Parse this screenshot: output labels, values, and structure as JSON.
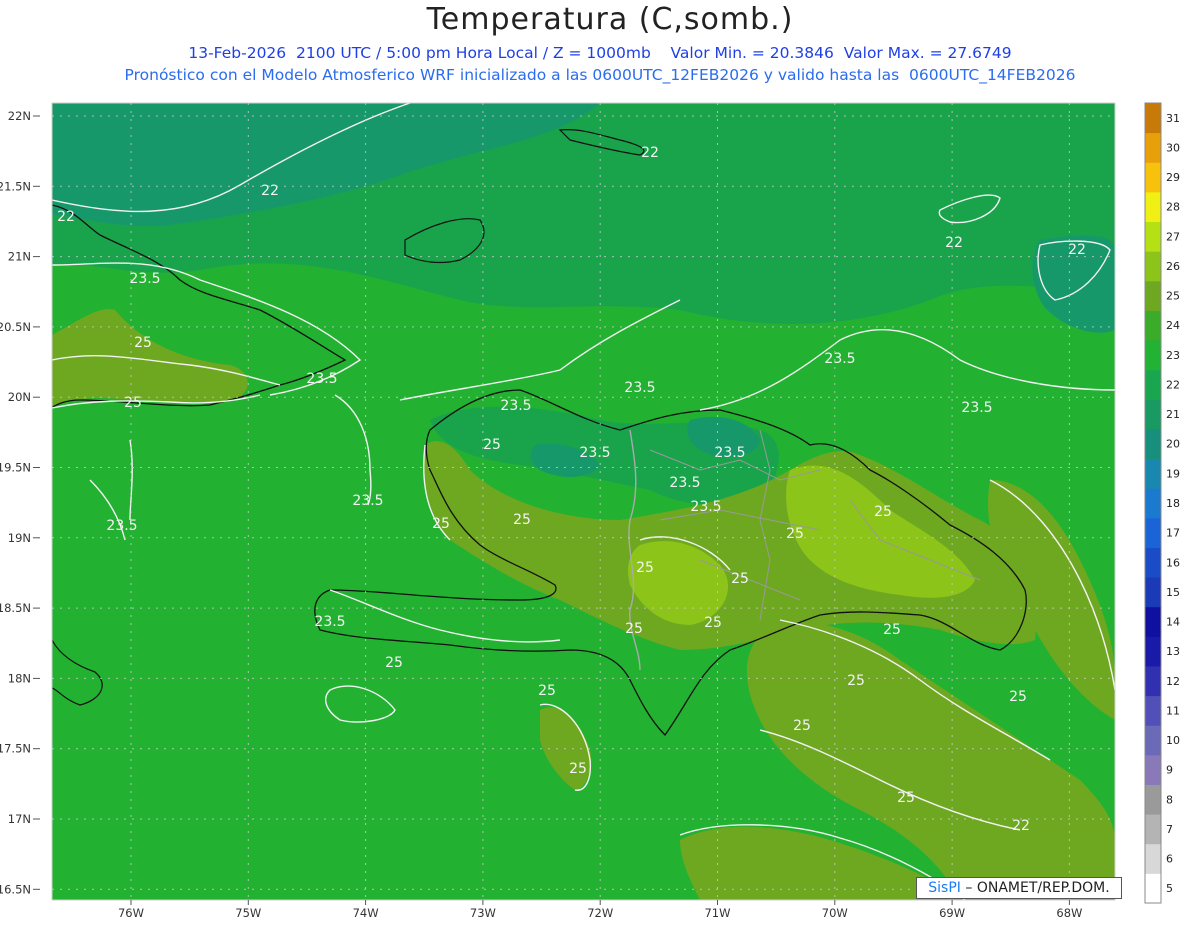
{
  "title": "Temperatura (C,somb.)",
  "subtitle_line1": "13-Feb-2026  2100 UTC / 5:00 pm Hora Local / Z = 1000mb    Valor Min. = 20.3846  Valor Max. = 27.6749",
  "subtitle_line2": "Pronóstico con el Modelo Atmosferico WRF inicializado a las 0600UTC_12FEB2026 y valido hasta las  0600UTC_14FEB2026",
  "credit": {
    "brand": "SisPI",
    "text": " – ONAMET/REP.DOM."
  },
  "lat_labels": [
    "22N",
    "21.5N",
    "21N",
    "20.5N",
    "20N",
    "19.5N",
    "19N",
    "18.5N",
    "18N",
    "17.5N",
    "17N",
    "16.5N"
  ],
  "lon_labels": [
    "76W",
    "75W",
    "74W",
    "73W",
    "72W",
    "71W",
    "70W",
    "69W",
    "68W"
  ],
  "colorbar": {
    "labels": [
      "5",
      "6",
      "7",
      "8",
      "9",
      "10",
      "11",
      "12",
      "13",
      "14",
      "15",
      "16",
      "17",
      "18",
      "19",
      "20",
      "21",
      "22",
      "23",
      "24",
      "25",
      "26",
      "27",
      "28",
      "29",
      "30",
      "31"
    ],
    "colors": [
      "#ffffff",
      "#d8d8d8",
      "#b4b4b4",
      "#9a9a9a",
      "#8a79b8",
      "#6a6ab8",
      "#5050b8",
      "#3030b0",
      "#1a1aa8",
      "#1010a0",
      "#1a3ab8",
      "#1a4cc8",
      "#1a64d8",
      "#1a7ad0",
      "#1888b0",
      "#16907c",
      "#189a62",
      "#1aa64e",
      "#22b234",
      "#3aac2a",
      "#6ea820",
      "#8cc41a",
      "#b4e014",
      "#f0f014",
      "#f8c20c",
      "#e8a00a",
      "#c87a08"
    ]
  },
  "contour_labels": [
    {
      "text": "22",
      "kind": "sea"
    },
    {
      "text": "22",
      "kind": "sea"
    },
    {
      "text": "22",
      "kind": "sea"
    },
    {
      "text": "22",
      "kind": "sea"
    },
    {
      "text": "22",
      "kind": "sea"
    },
    {
      "text": "23.5",
      "kind": "sea"
    },
    {
      "text": "23.5",
      "kind": "sea"
    },
    {
      "text": "23.5",
      "kind": "sea"
    },
    {
      "text": "23.5",
      "kind": "sea"
    },
    {
      "text": "23.5",
      "kind": "sea"
    },
    {
      "text": "23.5",
      "kind": "sea"
    },
    {
      "text": "23.5",
      "kind": "sea"
    },
    {
      "text": "23.5",
      "kind": "sea"
    },
    {
      "text": "23.5",
      "kind": "sea"
    },
    {
      "text": "23.5",
      "kind": "sea"
    },
    {
      "text": "23.5",
      "kind": "sea"
    },
    {
      "text": "23.5",
      "kind": "sea"
    },
    {
      "text": "23.5",
      "kind": "sea"
    },
    {
      "text": "25",
      "kind": "sea"
    },
    {
      "text": "25",
      "kind": "sea"
    },
    {
      "text": "25",
      "kind": "sea"
    },
    {
      "text": "25",
      "kind": "sea"
    },
    {
      "text": "25",
      "kind": "sea"
    },
    {
      "text": "25",
      "kind": "sea"
    },
    {
      "text": "25",
      "kind": "sea"
    },
    {
      "text": "25",
      "kind": "sea"
    },
    {
      "text": "25",
      "kind": "sea"
    },
    {
      "text": "25",
      "kind": "sea"
    },
    {
      "text": "25",
      "kind": "sea"
    },
    {
      "text": "25",
      "kind": "sea"
    },
    {
      "text": "25",
      "kind": "sea"
    },
    {
      "text": "25",
      "kind": "sea"
    },
    {
      "text": "25",
      "kind": "sea"
    },
    {
      "text": "25",
      "kind": "sea"
    },
    {
      "text": "25",
      "kind": "sea"
    },
    {
      "text": "25",
      "kind": "sea"
    },
    {
      "text": "25",
      "kind": "sea"
    },
    {
      "text": "22",
      "kind": "sea"
    }
  ]
}
